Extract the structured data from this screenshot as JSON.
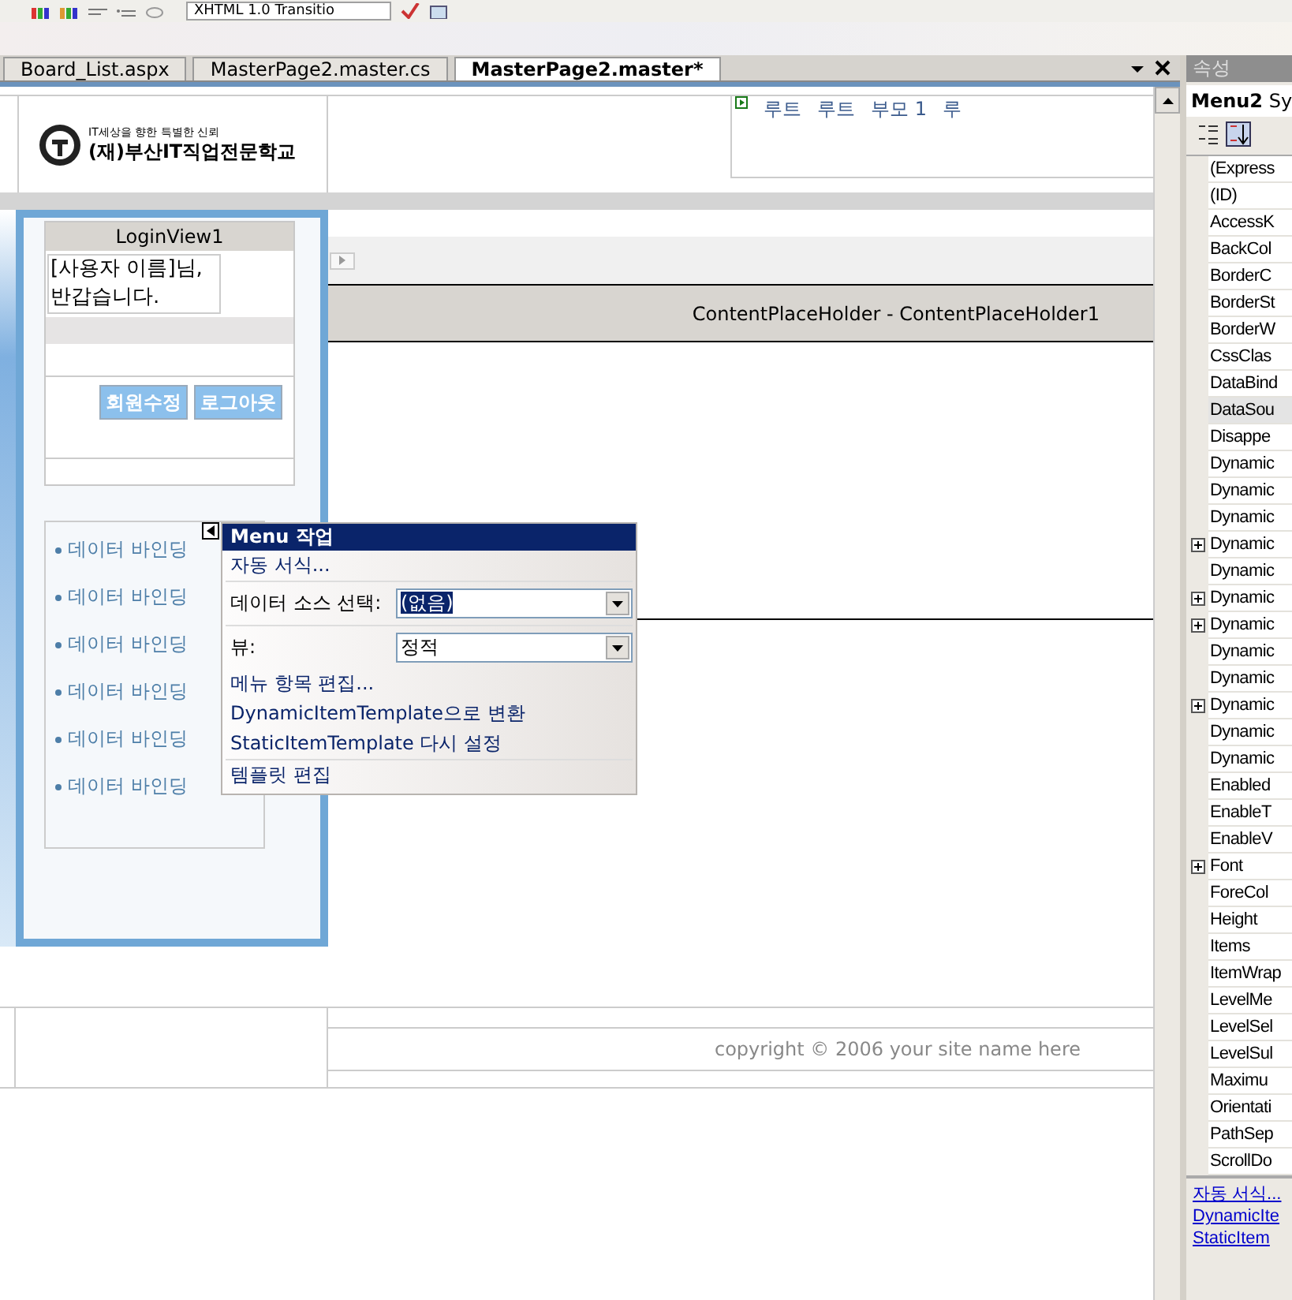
{
  "toolbar": {
    "doctype": "XHTML 1.0 Transitio"
  },
  "tabs": [
    {
      "label": "Board_List.aspx",
      "selected": false
    },
    {
      "label": "MasterPage2.master.cs",
      "selected": false
    },
    {
      "label": "MasterPage2.master*",
      "selected": true
    }
  ],
  "designer": {
    "logo": {
      "slogan": "IT세상을 향한 특별한 신뢰",
      "name": "(재)부산IT직업전문학교"
    },
    "breadcrumb": [
      "루트",
      "루트",
      "부모 1",
      "루"
    ],
    "login_view": {
      "title": "LoginView1",
      "greeting": "[사용자 이름]님, 반갑습니다.",
      "buttons": [
        "회원수정",
        "로그아웃"
      ]
    },
    "menu_items": [
      "데이터 바인딩",
      "데이터 바인딩",
      "데이터 바인딩",
      "데이터 바인딩",
      "데이터 바인딩",
      "데이터 바인딩"
    ],
    "content_placeholder": "ContentPlaceHolder - ContentPlaceHolder1",
    "footer": "copyright © 2006 your site name here"
  },
  "smart_tag": {
    "title": "Menu 작업",
    "auto_format": "자동 서식...",
    "fields": [
      {
        "label": "데이터 소스 선택:",
        "value": "(없음)",
        "text_selected": true
      },
      {
        "label": "뷰:",
        "value": "정적",
        "text_selected": false
      }
    ],
    "links": [
      "메뉴 항목 편집...",
      "DynamicItemTemplate으로 변환",
      "StaticItemTemplate 다시 설정"
    ],
    "footer_link": "템플릿 편집"
  },
  "properties": {
    "title": "속성",
    "object": "**Menu2** Sy",
    "rows": [
      {
        "name": "(Express",
        "kind": "plain",
        "selected": false
      },
      {
        "name": "(ID)",
        "kind": "plain",
        "selected": false
      },
      {
        "name": "AccessK",
        "kind": "plain",
        "selected": false
      },
      {
        "name": "BackCol",
        "kind": "plain",
        "selected": false
      },
      {
        "name": "BorderC",
        "kind": "plain",
        "selected": false
      },
      {
        "name": "BorderSt",
        "kind": "plain",
        "selected": false
      },
      {
        "name": "BorderW",
        "kind": "plain",
        "selected": false
      },
      {
        "name": "CssClas",
        "kind": "plain",
        "selected": false
      },
      {
        "name": "DataBind",
        "kind": "plain",
        "selected": false
      },
      {
        "name": "DataSou",
        "kind": "plain",
        "selected": true
      },
      {
        "name": "Disappe",
        "kind": "plain",
        "selected": false
      },
      {
        "name": "Dynamic",
        "kind": "plain",
        "selected": false
      },
      {
        "name": "Dynamic",
        "kind": "plain",
        "selected": false
      },
      {
        "name": "Dynamic",
        "kind": "plain",
        "selected": false
      },
      {
        "name": "Dynamic",
        "kind": "group",
        "selected": false
      },
      {
        "name": "Dynamic",
        "kind": "plain",
        "selected": false
      },
      {
        "name": "Dynamic",
        "kind": "group",
        "selected": false
      },
      {
        "name": "Dynamic",
        "kind": "group",
        "selected": false
      },
      {
        "name": "Dynamic",
        "kind": "plain",
        "selected": false
      },
      {
        "name": "Dynamic",
        "kind": "plain",
        "selected": false
      },
      {
        "name": "Dynamic",
        "kind": "group",
        "selected": false
      },
      {
        "name": "Dynamic",
        "kind": "plain",
        "selected": false
      },
      {
        "name": "Dynamic",
        "kind": "plain",
        "selected": false
      },
      {
        "name": "Enabled",
        "kind": "plain",
        "selected": false
      },
      {
        "name": "EnableT",
        "kind": "plain",
        "selected": false
      },
      {
        "name": "EnableV",
        "kind": "plain",
        "selected": false
      },
      {
        "name": "Font",
        "kind": "group",
        "selected": false
      },
      {
        "name": "ForeCol",
        "kind": "plain",
        "selected": false
      },
      {
        "name": "Height",
        "kind": "plain",
        "selected": false
      },
      {
        "name": "Items",
        "kind": "plain",
        "selected": false
      },
      {
        "name": "ItemWrap",
        "kind": "plain",
        "selected": false
      },
      {
        "name": "LevelMe",
        "kind": "plain",
        "selected": false
      },
      {
        "name": "LevelSel",
        "kind": "plain",
        "selected": false
      },
      {
        "name": "LevelSul",
        "kind": "plain",
        "selected": false
      },
      {
        "name": "Maximu",
        "kind": "plain",
        "selected": false
      },
      {
        "name": "Orientati",
        "kind": "plain",
        "selected": false
      },
      {
        "name": "PathSep",
        "kind": "plain",
        "selected": false
      },
      {
        "name": "ScrollDo",
        "kind": "plain",
        "selected": false
      }
    ],
    "links": [
      "자동 서식...",
      "DynamicIte",
      "StaticItem"
    ]
  }
}
